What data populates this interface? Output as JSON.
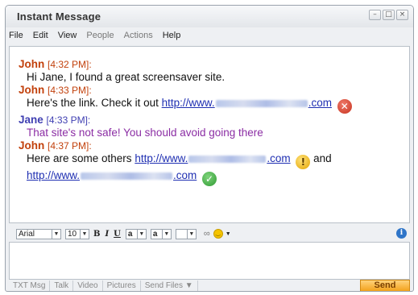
{
  "window": {
    "title": "Instant Message",
    "controls": [
      "–",
      "□",
      "×"
    ]
  },
  "menu": [
    {
      "label": "File"
    },
    {
      "label": "Edit"
    },
    {
      "label": "View"
    },
    {
      "label": "People"
    },
    {
      "label": "Actions"
    },
    {
      "label": "Help"
    }
  ],
  "messages": {
    "m1": {
      "sender": "John",
      "time": "[4:32 PM]:",
      "text": "Hi Jane, I found a great screensaver site."
    },
    "m2": {
      "sender": "John",
      "time": "[4:33 PM]:",
      "text": "Here's the link. Check it out ",
      "link_prefix": "http://www.",
      "link_suffix": ".com"
    },
    "m3": {
      "sender": "Jane",
      "time": "[4:33 PM]:",
      "text": "That site's not safe!  You should avoid going there"
    },
    "m4": {
      "sender": "John",
      "time": "[4:37 PM]:",
      "text": "Here are some others ",
      "link_prefix": "http://www.",
      "link_suffix": ".com",
      "and": " and",
      "link2_prefix": "http://www.",
      "link2_suffix": ".com"
    }
  },
  "toolbar": {
    "font": "Arial",
    "size": "10",
    "bold": "B",
    "italic": "I",
    "underline": "U",
    "text_color": "a",
    "bg_color": "a"
  },
  "tabs": [
    "TXT Msg",
    "Talk",
    "Video",
    "Pictures",
    "Send Files ▼"
  ],
  "send_label": "Send",
  "icons": {
    "unsafe": "red-x-icon",
    "warning": "warning-icon",
    "safe": "green-check-icon",
    "emoticon": "smiley-icon",
    "link": "link-icon",
    "info": "info-icon"
  },
  "colors": {
    "john": "#c2410c",
    "jane": "#3f3fb2",
    "jane_text": "#8b2da4",
    "send": "#f3a21c"
  }
}
